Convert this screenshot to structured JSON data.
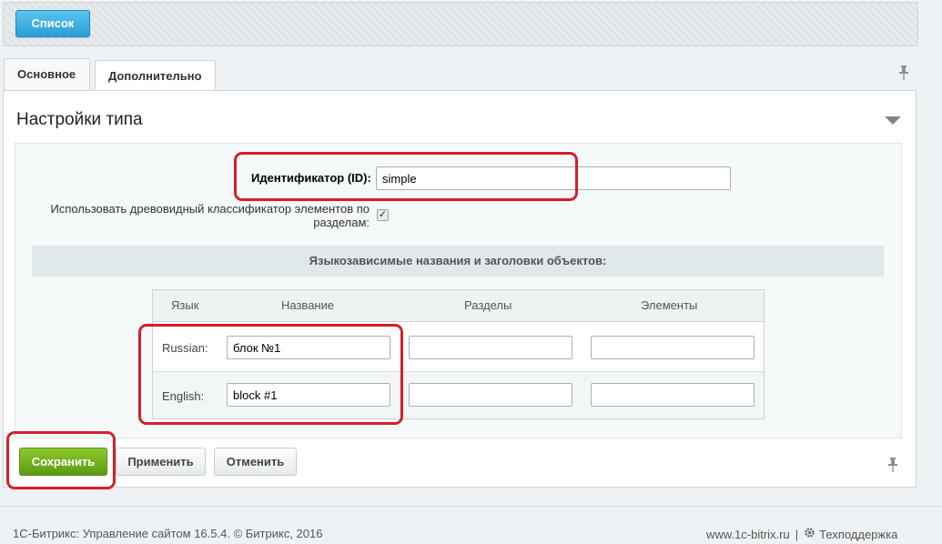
{
  "toolbar": {
    "list_label": "Список"
  },
  "tabs": [
    {
      "label": "Основное",
      "active": true
    },
    {
      "label": "Дополнительно",
      "active": false
    }
  ],
  "panel": {
    "title": "Настройки типа"
  },
  "form": {
    "id_label": "Идентификатор (ID):",
    "id_value": "simple",
    "tree_label": "Использовать древовидный классификатор элементов по разделам:",
    "tree_checked": true,
    "section_heading": "Языкозависимые названия и заголовки объектов:"
  },
  "lang_table": {
    "headers": [
      "Язык",
      "Название",
      "Разделы",
      "Элементы"
    ],
    "rows": [
      {
        "lang": "Russian:",
        "name": "блок №1",
        "sections": "",
        "elements": ""
      },
      {
        "lang": "English:",
        "name": "block #1",
        "sections": "",
        "elements": ""
      }
    ]
  },
  "buttons": {
    "save": "Сохранить",
    "apply": "Применить",
    "cancel": "Отменить"
  },
  "footer": {
    "copyright": "1С-Битрикс: Управление сайтом 16.5.4. © Битрикс, 2016",
    "site": "www.1c-bitrix.ru",
    "separator": "|",
    "support": "Техподдержка"
  },
  "colors": {
    "highlight": "#d4202a",
    "save_green": "#6ea81c",
    "list_blue": "#2a9fd8"
  },
  "icons": {
    "pin": "pin-icon",
    "collapse": "triangle-down-icon",
    "support": "gear-icon",
    "check": "checkmark-icon"
  }
}
